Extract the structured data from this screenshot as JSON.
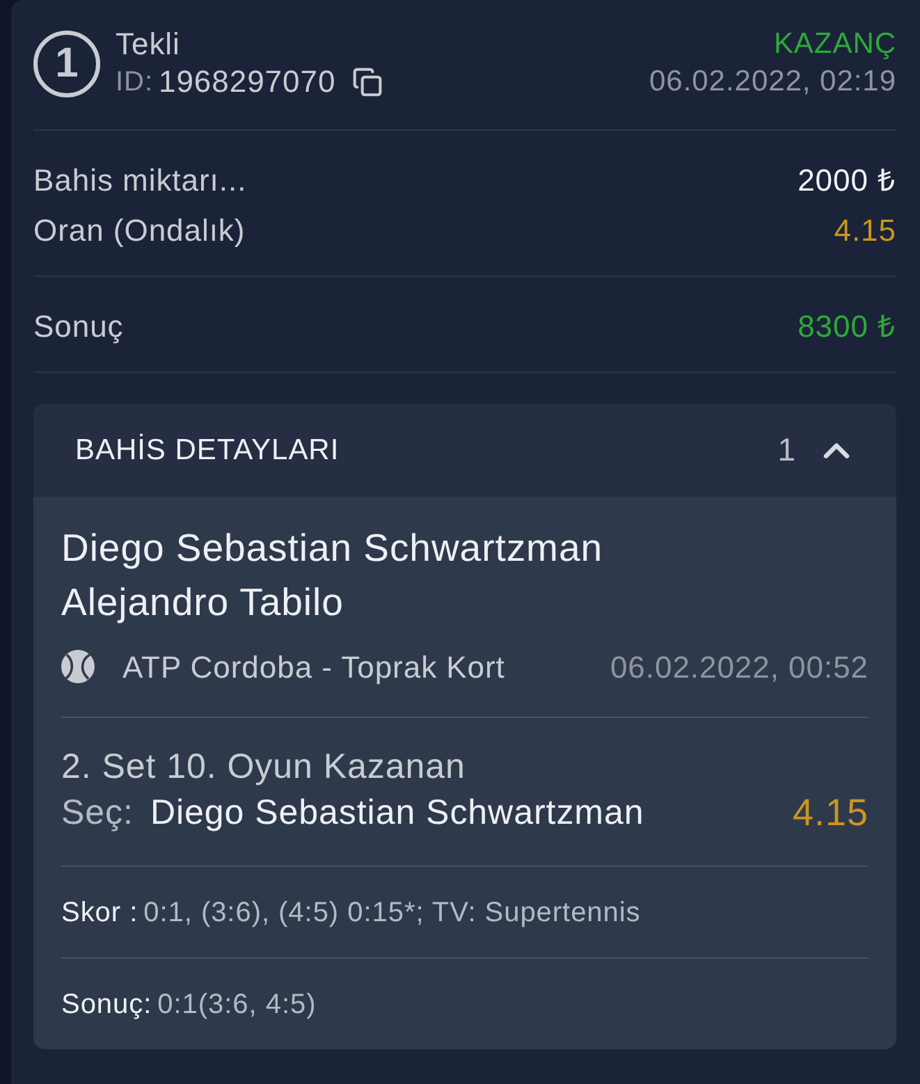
{
  "bet": {
    "number": "1",
    "type": "Tekli",
    "id_label": "ID:",
    "id": "1968297070",
    "status": {
      "text": "KAZANÇ",
      "kind": "won"
    },
    "datetime": "06.02.2022, 02:19"
  },
  "summary_groups": [
    {
      "rows": [
        {
          "label": "Bahis miktarı...",
          "value": "2000 ₺",
          "kind": "amount"
        },
        {
          "label": "Oran (Ondalık)",
          "value": "4.15",
          "kind": "odds"
        }
      ]
    },
    {
      "rows": [
        {
          "label": "Sonuç",
          "value": "8300 ₺",
          "kind": "payout"
        }
      ]
    }
  ],
  "details": {
    "title": "BAHİS DETAYLARI",
    "count": "1",
    "expanded": true,
    "events": [
      {
        "teams": [
          "Diego Sebastian Schwartzman",
          "Alejandro Tabilo"
        ],
        "league": "ATP Cordoba - Toprak Kort",
        "start": "06.02.2022, 00:52",
        "market": "2. Set 10. Oyun Kazanan",
        "pick_label": "Seç:",
        "pick": "Diego Sebastian Schwartzman",
        "odds": "4.15",
        "score_label": "Skor :",
        "score": "0:1, (3:6), (4:5) 0:15*; TV: Supertennis",
        "result_label": "Sonuç:",
        "result": "0:1(3:6, 4:5)"
      }
    ]
  }
}
